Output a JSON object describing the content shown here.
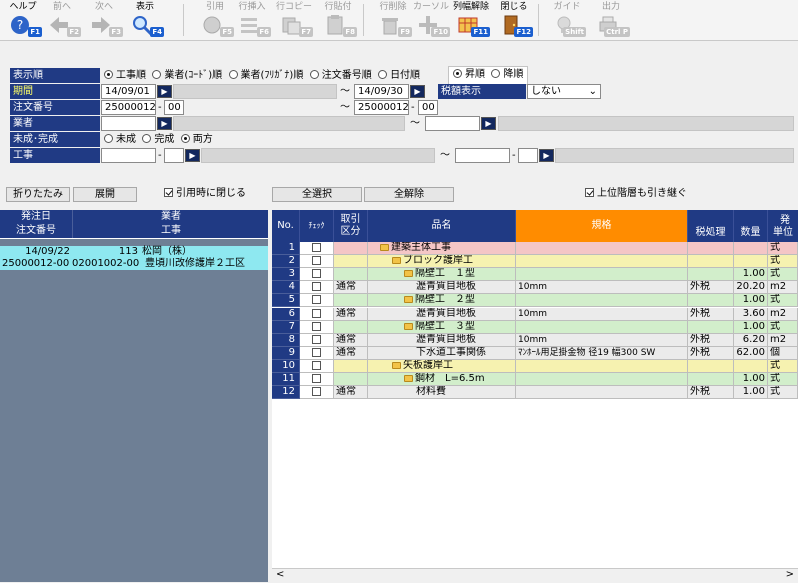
{
  "toolbar": [
    {
      "label": "ヘルプ",
      "key": "F1",
      "icon": "help-icon",
      "enabled": true
    },
    {
      "label": "前へ",
      "key": "F2",
      "icon": "arrow-left-icon",
      "enabled": false
    },
    {
      "label": "次へ",
      "key": "F3",
      "icon": "arrow-right-icon",
      "enabled": false
    },
    {
      "label": "表示",
      "key": "F4",
      "icon": "magnifier-icon",
      "enabled": true
    },
    {
      "label": "引用",
      "key": "F5",
      "icon": "quote-icon",
      "enabled": false
    },
    {
      "label": "行挿入",
      "key": "F6",
      "icon": "row-insert-icon",
      "enabled": false
    },
    {
      "label": "行コピー",
      "key": "F7",
      "icon": "row-copy-icon",
      "enabled": false
    },
    {
      "label": "行貼付",
      "key": "F8",
      "icon": "row-paste-icon",
      "enabled": false
    },
    {
      "label": "行削除",
      "key": "F9",
      "icon": "row-delete-icon",
      "enabled": false
    },
    {
      "label": "カーソル",
      "key": "F10",
      "icon": "cursor-icon",
      "enabled": false
    },
    {
      "label": "列幅解除",
      "key": "F11",
      "icon": "column-width-icon",
      "enabled": true
    },
    {
      "label": "閉じる",
      "key": "F12",
      "icon": "door-icon",
      "enabled": true
    },
    {
      "label": "ガイド",
      "key": "Shift",
      "icon": "guide-bulb-icon",
      "enabled": false
    },
    {
      "label": "出力",
      "key": "Ctrl P",
      "icon": "output-icon",
      "enabled": false
    }
  ],
  "form": {
    "sort_label": "表示順",
    "sort_options": [
      "工事順",
      "業者(ｺｰﾄﾞ)順",
      "業者(ﾌﾘｶﾞﾅ)順",
      "注文番号順",
      "日付順"
    ],
    "order_options": [
      "昇順",
      "降順"
    ],
    "period_label": "期間",
    "period_from": "14/09/01",
    "period_tilde": "～",
    "period_to": "14/09/30",
    "tax_label": "税額表示",
    "tax_value": "しない",
    "order_label": "注文番号",
    "order_from_main": "25000012",
    "order_from_sub": "00",
    "order_to_main": "25000012",
    "order_to_sub": "00",
    "dash": "-",
    "vendor_label": "業者",
    "status_label": "未成･完成",
    "status_options": [
      "未成",
      "完成",
      "両方"
    ],
    "project_label": "工事"
  },
  "buttons": {
    "fold": "折りたたみ",
    "expand": "展開",
    "close_on_quote": "引用時に閉じる",
    "select_all": "全選択",
    "deselect_all": "全解除",
    "inherit_upper": "上位階層も引き継ぐ"
  },
  "left_panel": {
    "headers": {
      "date": "発注日",
      "vendor": "業者",
      "order_no": "注文番号",
      "project": "工事"
    },
    "row": {
      "date": "14/09/22",
      "vendor_code": "113",
      "vendor_name": "松岡（株）",
      "order_no": "25000012-00",
      "project_code": "02001002-00",
      "project_name": "豊頃川改修護岸２工区"
    }
  },
  "grid": {
    "headers": {
      "no": "No.",
      "check": "ﾁｪｯｸ",
      "type1": "取引",
      "type2": "区分",
      "name": "品名",
      "spec": "規格",
      "tax": "税処理",
      "qty": "数量",
      "unit1": "単位",
      "top_right": "発"
    },
    "rows": [
      {
        "no": "1",
        "type": "",
        "level": 0,
        "folder": true,
        "name": "建築主体工事",
        "spec": "",
        "tax": "",
        "qty": "",
        "unit": "式",
        "bg": "#f4c6c6"
      },
      {
        "no": "2",
        "type": "",
        "level": 1,
        "folder": true,
        "name": "ブロック護岸工",
        "spec": "",
        "tax": "",
        "qty": "",
        "unit": "式",
        "bg": "#f6f2b0"
      },
      {
        "no": "3",
        "type": "",
        "level": 2,
        "folder": true,
        "name": "隔壁工　１型",
        "spec": "",
        "tax": "",
        "qty": "1.00",
        "unit": "式",
        "bg": "#d2eecb"
      },
      {
        "no": "4",
        "type": "通常",
        "level": 3,
        "folder": false,
        "name": "瀝青質目地板",
        "spec": "10mm",
        "tax": "外税",
        "qty": "20.20",
        "unit": "m2",
        "bg": "#ebebeb"
      },
      {
        "no": "5",
        "type": "",
        "level": 2,
        "folder": true,
        "name": "隔壁工　２型",
        "spec": "",
        "tax": "",
        "qty": "1.00",
        "unit": "式",
        "bg": "#d2eecb"
      },
      {
        "no": "6",
        "type": "通常",
        "level": 3,
        "folder": false,
        "name": "瀝青質目地板",
        "spec": "10mm",
        "tax": "外税",
        "qty": "3.60",
        "unit": "m2",
        "bg": "#ebebeb"
      },
      {
        "no": "7",
        "type": "",
        "level": 2,
        "folder": true,
        "name": "隔壁工　３型",
        "spec": "",
        "tax": "",
        "qty": "1.00",
        "unit": "式",
        "bg": "#d2eecb"
      },
      {
        "no": "8",
        "type": "通常",
        "level": 3,
        "folder": false,
        "name": "瀝青質目地板",
        "spec": "10mm",
        "tax": "外税",
        "qty": "6.20",
        "unit": "m2",
        "bg": "#ebebeb"
      },
      {
        "no": "9",
        "type": "通常",
        "level": 3,
        "folder": false,
        "name": "下水道工事関係",
        "spec": "ﾏﾝﾎｰﾙ用足掛金物 径19 幅300 SW",
        "tax": "外税",
        "qty": "62.00",
        "unit": "個",
        "bg": "#ebebeb"
      },
      {
        "no": "10",
        "type": "",
        "level": 1,
        "folder": true,
        "name": "矢板護岸工",
        "spec": "",
        "tax": "",
        "qty": "",
        "unit": "式",
        "bg": "#f6f2b0"
      },
      {
        "no": "11",
        "type": "",
        "level": 2,
        "folder": true,
        "name": "鋼材　L=6.5m",
        "spec": "",
        "tax": "",
        "qty": "1.00",
        "unit": "式",
        "bg": "#d2eecb"
      },
      {
        "no": "12",
        "type": "通常",
        "level": 3,
        "folder": false,
        "name": "材料費",
        "spec": "",
        "tax": "外税",
        "qty": "1.00",
        "unit": "式",
        "bg": "#ebebeb"
      }
    ]
  },
  "scrollbar": {
    "left": "<",
    "right": ">"
  },
  "colors": {
    "header_blue": "#203a84",
    "spec_orange": "#ff8c00",
    "fkey_blue": "#1b5fcf",
    "left_panel": "#6e7f95",
    "left_row": "#8ee8f0"
  }
}
